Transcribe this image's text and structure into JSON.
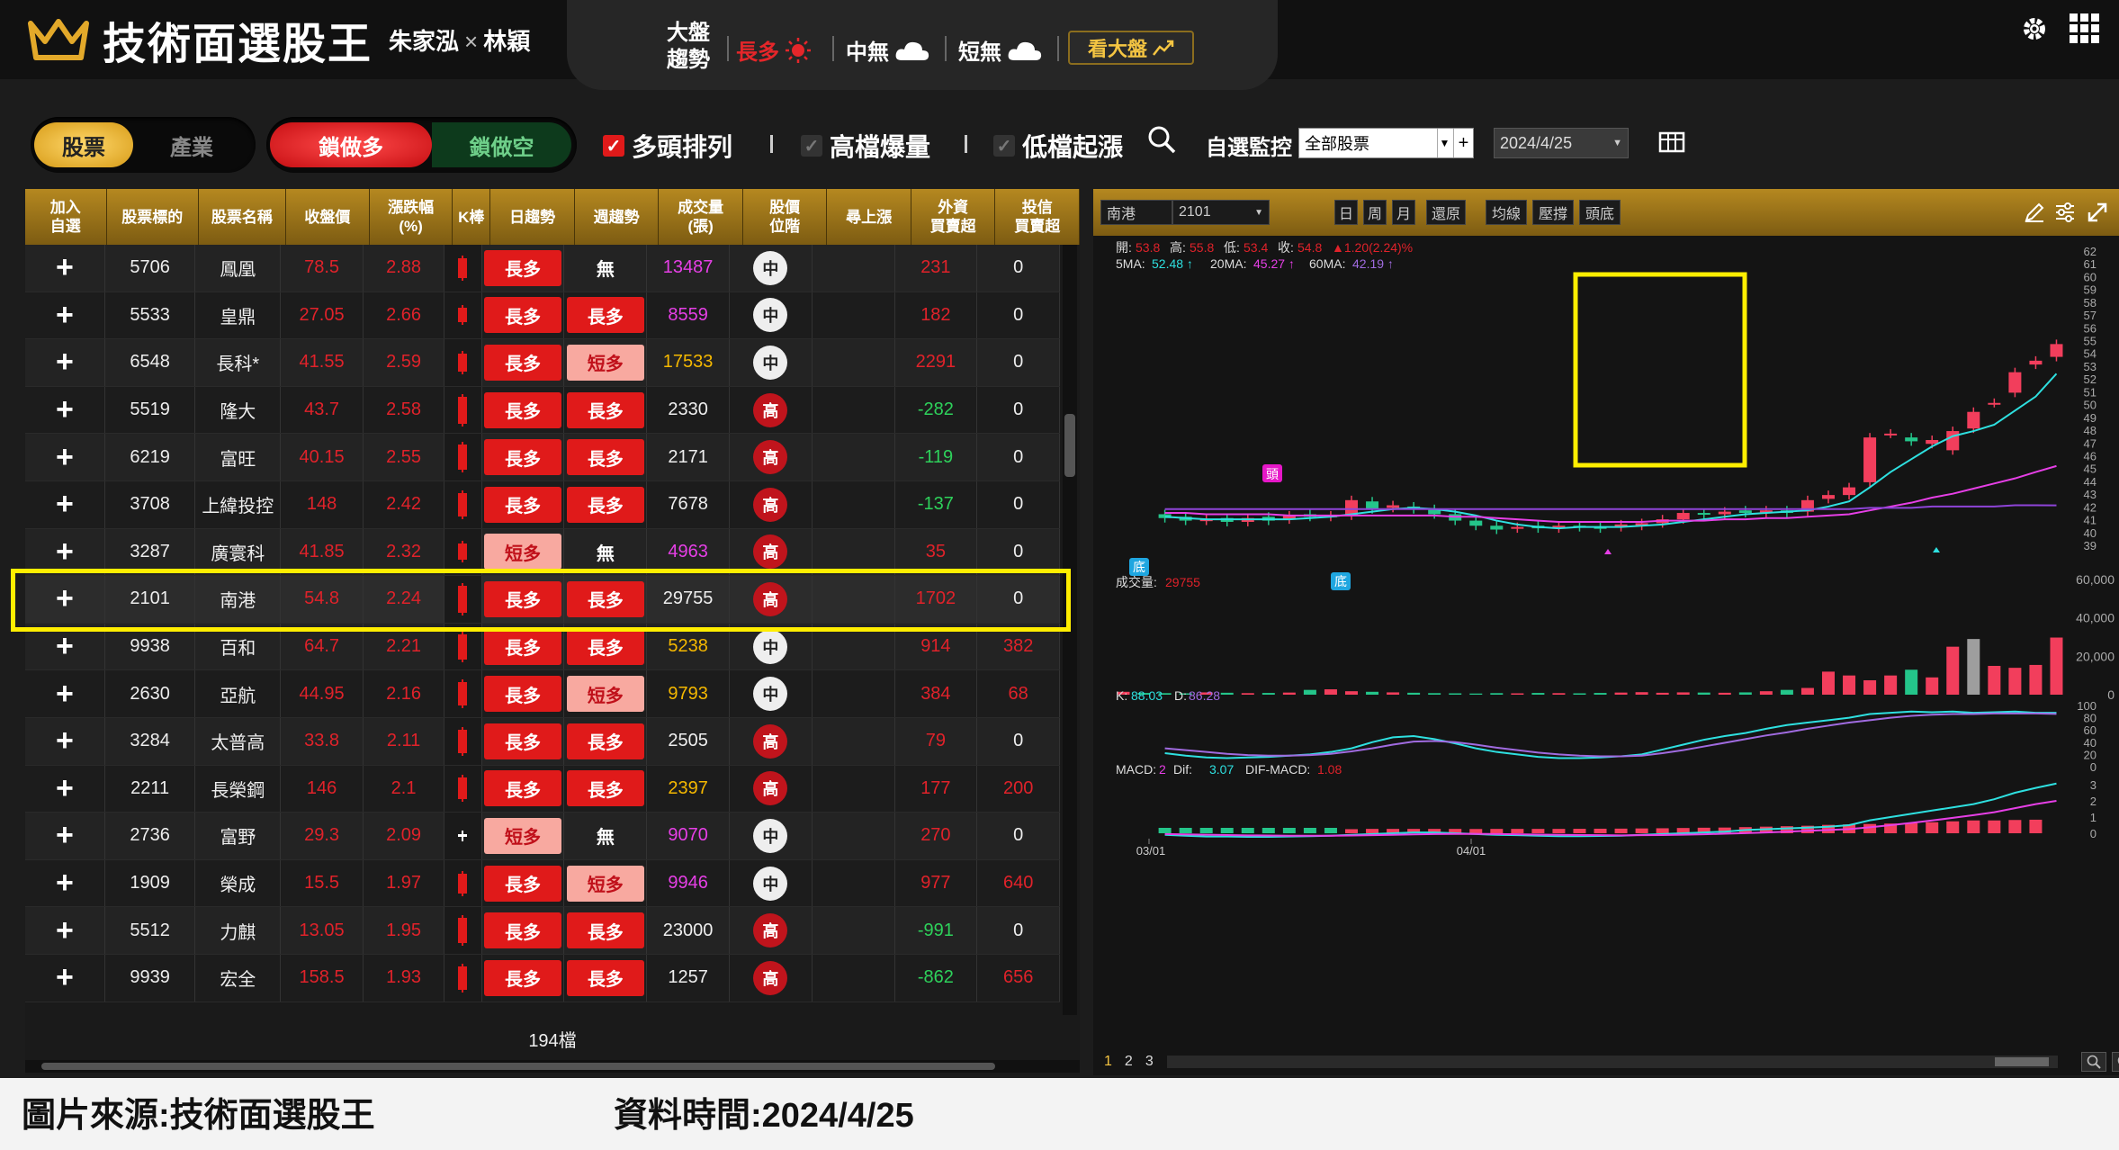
{
  "app": {
    "title": "技術面選股王",
    "host_1": "朱家泓",
    "host_x": "×",
    "host_2": "林穎"
  },
  "market_trend": {
    "label_line1": "大盤",
    "label_line2": "趨勢",
    "long": "長多",
    "mid": "中無",
    "short": "短無",
    "see_market": "看大盤"
  },
  "toolbar": {
    "tab_stocks": "股票",
    "tab_industry": "產業",
    "tab_lock_long": "鎖做多",
    "tab_lock_short": "鎖做空",
    "filter_1": "多頭排列",
    "filter_1_checked": true,
    "filter_2": "高檔爆量",
    "filter_2_checked": false,
    "filter_3": "低檔起漲",
    "filter_3_checked": false,
    "watch_label": "自選監控",
    "watch_value": "全部股票",
    "date_value": "2024/4/25"
  },
  "table": {
    "headers": [
      "加入\n自選",
      "股票標的",
      "股票名稱",
      "收盤價",
      "漲跌幅\n(%)",
      "K棒",
      "日趨勢",
      "週趨勢",
      "成交量\n(張)",
      "股價\n位階",
      "尋上漲",
      "外資\n買賣超",
      "投信\n買賣超"
    ],
    "rows": [
      {
        "add": "+",
        "code": "5706",
        "name": "鳳凰",
        "close": "78.5",
        "chg": "2.88",
        "day": "長多",
        "day_t": "long",
        "week": "無",
        "week_t": "none",
        "vol": "13487",
        "vol_c": "mag",
        "pos": "中",
        "pos_t": "mid",
        "fi": "231",
        "fi_c": "red",
        "it": "0",
        "it_c": "white"
      },
      {
        "add": "+",
        "code": "5533",
        "name": "皇鼎",
        "close": "27.05",
        "chg": "2.66",
        "day": "長多",
        "day_t": "long",
        "week": "長多",
        "week_t": "long",
        "vol": "8559",
        "vol_c": "mag",
        "pos": "中",
        "pos_t": "mid",
        "fi": "182",
        "fi_c": "red",
        "it": "0",
        "it_c": "white"
      },
      {
        "add": "+",
        "code": "6548",
        "name": "長科*",
        "close": "41.55",
        "chg": "2.59",
        "day": "長多",
        "day_t": "long",
        "week": "短多",
        "week_t": "short",
        "vol": "17533",
        "vol_c": "yel",
        "pos": "中",
        "pos_t": "mid",
        "fi": "2291",
        "fi_c": "red",
        "it": "0",
        "it_c": "white"
      },
      {
        "add": "+",
        "code": "5519",
        "name": "隆大",
        "close": "43.7",
        "chg": "2.58",
        "day": "長多",
        "day_t": "long",
        "week": "長多",
        "week_t": "long",
        "vol": "2330",
        "vol_c": "white",
        "pos": "高",
        "pos_t": "high",
        "fi": "-282",
        "fi_c": "green",
        "it": "0",
        "it_c": "white"
      },
      {
        "add": "+",
        "code": "6219",
        "name": "富旺",
        "close": "40.15",
        "chg": "2.55",
        "day": "長多",
        "day_t": "long",
        "week": "長多",
        "week_t": "long",
        "vol": "2171",
        "vol_c": "white",
        "pos": "高",
        "pos_t": "high",
        "fi": "-119",
        "fi_c": "green",
        "it": "0",
        "it_c": "white"
      },
      {
        "add": "+",
        "code": "3708",
        "name": "上緯投控",
        "close": "148",
        "chg": "2.42",
        "day": "長多",
        "day_t": "long",
        "week": "長多",
        "week_t": "long",
        "vol": "7678",
        "vol_c": "white",
        "pos": "高",
        "pos_t": "high",
        "fi": "-137",
        "fi_c": "green",
        "it": "0",
        "it_c": "white"
      },
      {
        "add": "+",
        "code": "3287",
        "name": "廣寰科",
        "close": "41.85",
        "chg": "2.32",
        "day": "短多",
        "day_t": "short",
        "week": "無",
        "week_t": "none",
        "vol": "4963",
        "vol_c": "mag",
        "pos": "高",
        "pos_t": "high",
        "fi": "35",
        "fi_c": "red",
        "it": "0",
        "it_c": "white"
      },
      {
        "add": "+",
        "code": "2101",
        "name": "南港",
        "close": "54.8",
        "chg": "2.24",
        "day": "長多",
        "day_t": "long",
        "week": "長多",
        "week_t": "long",
        "vol": "29755",
        "vol_c": "white",
        "pos": "高",
        "pos_t": "high",
        "fi": "1702",
        "fi_c": "red",
        "it": "0",
        "it_c": "white"
      },
      {
        "add": "+",
        "code": "9938",
        "name": "百和",
        "close": "64.7",
        "chg": "2.21",
        "day": "長多",
        "day_t": "long",
        "week": "長多",
        "week_t": "long",
        "vol": "5238",
        "vol_c": "yel",
        "pos": "中",
        "pos_t": "mid",
        "fi": "914",
        "fi_c": "red",
        "it": "382",
        "it_c": "red"
      },
      {
        "add": "+",
        "code": "2630",
        "name": "亞航",
        "close": "44.95",
        "chg": "2.16",
        "day": "長多",
        "day_t": "long",
        "week": "短多",
        "week_t": "short",
        "vol": "9793",
        "vol_c": "yel",
        "pos": "中",
        "pos_t": "mid",
        "fi": "384",
        "fi_c": "red",
        "it": "68",
        "it_c": "red"
      },
      {
        "add": "+",
        "code": "3284",
        "name": "太普高",
        "close": "33.8",
        "chg": "2.11",
        "day": "長多",
        "day_t": "long",
        "week": "長多",
        "week_t": "long",
        "vol": "2505",
        "vol_c": "white",
        "pos": "高",
        "pos_t": "high",
        "fi": "79",
        "fi_c": "red",
        "it": "0",
        "it_c": "white"
      },
      {
        "add": "+",
        "code": "2211",
        "name": "長榮鋼",
        "close": "146",
        "chg": "2.1",
        "day": "長多",
        "day_t": "long",
        "week": "長多",
        "week_t": "long",
        "vol": "2397",
        "vol_c": "yel",
        "pos": "高",
        "pos_t": "high",
        "fi": "177",
        "fi_c": "red",
        "it": "200",
        "it_c": "red"
      },
      {
        "add": "+",
        "code": "2736",
        "name": "富野",
        "close": "29.3",
        "chg": "2.09",
        "day": "短多",
        "day_t": "short",
        "week": "無",
        "week_t": "none",
        "vol": "9070",
        "vol_c": "mag",
        "pos": "中",
        "pos_t": "mid",
        "fi": "270",
        "fi_c": "red",
        "it": "0",
        "it_c": "white"
      },
      {
        "add": "+",
        "code": "1909",
        "name": "榮成",
        "close": "15.5",
        "chg": "1.97",
        "day": "長多",
        "day_t": "long",
        "week": "短多",
        "week_t": "short",
        "vol": "9946",
        "vol_c": "mag",
        "pos": "中",
        "pos_t": "mid",
        "fi": "977",
        "fi_c": "red",
        "it": "640",
        "it_c": "red"
      },
      {
        "add": "+",
        "code": "5512",
        "name": "力麒",
        "close": "13.05",
        "chg": "1.95",
        "day": "長多",
        "day_t": "long",
        "week": "長多",
        "week_t": "long",
        "vol": "23000",
        "vol_c": "white",
        "pos": "高",
        "pos_t": "high",
        "fi": "-991",
        "fi_c": "green",
        "it": "0",
        "it_c": "white"
      },
      {
        "add": "+",
        "code": "9939",
        "name": "宏全",
        "close": "158.5",
        "chg": "1.93",
        "day": "長多",
        "day_t": "long",
        "week": "長多",
        "week_t": "long",
        "vol": "1257",
        "vol_c": "white",
        "pos": "高",
        "pos_t": "high",
        "fi": "-862",
        "fi_c": "green",
        "it": "656",
        "it_c": "red"
      }
    ],
    "count_text": "194檔"
  },
  "chart": {
    "symbol": "南港",
    "code": "2101",
    "btn_day": "日",
    "btn_week": "周",
    "btn_month": "月",
    "btn_restore": "還原",
    "btn_ma": "均線",
    "btn_sr": "壓撐",
    "btn_head": "頭底",
    "ohlc": {
      "open_l": "開:",
      "open": "53.8",
      "high_l": "高:",
      "high": "55.8",
      "low_l": "低:",
      "low": "53.4",
      "close_l": "收:",
      "close": "54.8",
      "chg": "▲1.20(2.24)%"
    },
    "ma": {
      "ma5_l": "5MA:",
      "ma5": "52.48",
      "ma20_l": "20MA:",
      "ma20": "45.27",
      "ma60_l": "60MA:",
      "ma60": "42.19"
    },
    "vol_label": "成交量:",
    "vol_value": "29755",
    "kd_k_l": "K:",
    "kd_k": "88.03",
    "kd_d_l": "D:",
    "kd_d": "86.28",
    "macd_l": "MACD:",
    "macd": "2",
    "dif_l": "Dif:",
    "dif": "3.07",
    "difmacd_l": "DIF-MACD:",
    "difmacd": "1.08",
    "head_tag": "頭",
    "bottom_tag": "底",
    "date_1": "03/01",
    "date_2": "04/01",
    "price_ticks": [
      "62",
      "61",
      "60",
      "59",
      "58",
      "57",
      "56",
      "55",
      "54",
      "53",
      "52",
      "51",
      "50",
      "49",
      "48",
      "47",
      "46",
      "45",
      "44",
      "43",
      "42",
      "41",
      "40",
      "39"
    ],
    "vol_ticks": [
      "60,000",
      "40,000",
      "20,000",
      "0"
    ],
    "kd_ticks": [
      "100",
      "80",
      "60",
      "40",
      "20",
      "0"
    ],
    "macd_ticks": [
      "3",
      "2",
      "1",
      "0"
    ],
    "pages": [
      "1",
      "2",
      "3"
    ]
  },
  "chart_data": {
    "type": "candlestick",
    "title": "南港 2101",
    "x_ticks": [
      "03/01",
      "04/01"
    ],
    "ylim": [
      39,
      62
    ],
    "candles": [
      {
        "o": 41.5,
        "c": 41.2
      },
      {
        "o": 41.3,
        "c": 41.0
      },
      {
        "o": 41.0,
        "c": 41.1
      },
      {
        "o": 41.2,
        "c": 40.9
      },
      {
        "o": 40.9,
        "c": 41.2
      },
      {
        "o": 41.3,
        "c": 41.0
      },
      {
        "o": 41.1,
        "c": 41.4
      },
      {
        "o": 41.5,
        "c": 41.3
      },
      {
        "o": 41.3,
        "c": 41.4
      },
      {
        "o": 41.4,
        "c": 42.6
      },
      {
        "o": 42.5,
        "c": 41.9
      },
      {
        "o": 42.0,
        "c": 42.2
      },
      {
        "o": 42.1,
        "c": 41.9
      },
      {
        "o": 41.9,
        "c": 41.5
      },
      {
        "o": 41.5,
        "c": 41.0
      },
      {
        "o": 41.0,
        "c": 40.6
      },
      {
        "o": 40.6,
        "c": 40.3
      },
      {
        "o": 40.4,
        "c": 40.5
      },
      {
        "o": 40.6,
        "c": 40.4
      },
      {
        "o": 40.4,
        "c": 40.6
      },
      {
        "o": 40.6,
        "c": 40.5
      },
      {
        "o": 40.5,
        "c": 40.4
      },
      {
        "o": 40.5,
        "c": 40.7
      },
      {
        "o": 40.6,
        "c": 40.8
      },
      {
        "o": 40.8,
        "c": 41.1
      },
      {
        "o": 41.1,
        "c": 41.6
      },
      {
        "o": 41.6,
        "c": 41.5
      },
      {
        "o": 41.5,
        "c": 41.7
      },
      {
        "o": 41.8,
        "c": 41.6
      },
      {
        "o": 41.6,
        "c": 41.8
      },
      {
        "o": 41.8,
        "c": 41.6
      },
      {
        "o": 41.7,
        "c": 42.6
      },
      {
        "o": 42.7,
        "c": 43.0
      },
      {
        "o": 43.0,
        "c": 43.6
      },
      {
        "o": 44.0,
        "c": 47.5
      },
      {
        "o": 47.8,
        "c": 47.8
      },
      {
        "o": 47.5,
        "c": 47.2
      },
      {
        "o": 47.0,
        "c": 47.3
      },
      {
        "o": 46.5,
        "c": 48.0
      },
      {
        "o": 48.2,
        "c": 49.5
      },
      {
        "o": 50.2,
        "c": 50.2
      },
      {
        "o": 51.0,
        "c": 52.6
      },
      {
        "o": 53.2,
        "c": 53.5
      },
      {
        "o": 53.8,
        "c": 54.8
      }
    ],
    "ma5": [
      41.3,
      41.2,
      41.1,
      41.1,
      41.1,
      41.1,
      41.1,
      41.2,
      41.3,
      41.5,
      41.7,
      41.9,
      42.0,
      41.9,
      41.7,
      41.4,
      41.0,
      40.7,
      40.5,
      40.4,
      40.5,
      40.5,
      40.5,
      40.6,
      40.7,
      40.9,
      41.1,
      41.3,
      41.5,
      41.6,
      41.7,
      41.8,
      42.1,
      42.5,
      43.6,
      44.8,
      45.8,
      46.8,
      47.6,
      48.0,
      48.5,
      49.6,
      50.7,
      52.48
    ],
    "ma20": [
      41.6,
      41.6,
      41.5,
      41.5,
      41.5,
      41.5,
      41.4,
      41.4,
      41.4,
      41.4,
      41.4,
      41.4,
      41.4,
      41.4,
      41.3,
      41.3,
      41.2,
      41.1,
      41.0,
      40.9,
      40.9,
      40.9,
      40.9,
      40.9,
      41.0,
      41.0,
      41.0,
      41.1,
      41.1,
      41.2,
      41.2,
      41.3,
      41.4,
      41.5,
      41.8,
      42.1,
      42.4,
      42.8,
      43.1,
      43.5,
      43.9,
      44.3,
      44.8,
      45.27
    ],
    "ma60": [
      41.9,
      41.9,
      41.9,
      41.9,
      41.9,
      41.9,
      41.9,
      41.9,
      41.9,
      41.9,
      41.9,
      41.9,
      41.9,
      41.9,
      41.9,
      41.9,
      41.9,
      41.9,
      41.9,
      41.9,
      41.9,
      41.9,
      41.9,
      41.9,
      41.9,
      41.9,
      41.9,
      41.9,
      41.9,
      41.9,
      41.9,
      41.9,
      41.9,
      41.9,
      42.0,
      42.0,
      42.0,
      42.1,
      42.1,
      42.1,
      42.1,
      42.2,
      42.2,
      42.19
    ],
    "volume": [
      1500,
      900,
      800,
      700,
      1200,
      1000,
      800,
      900,
      1100,
      2500,
      2800,
      1800,
      1500,
      1200,
      1000,
      800,
      700,
      600,
      800,
      700,
      900,
      800,
      700,
      900,
      1100,
      1300,
      1000,
      1200,
      1100,
      1000,
      1200,
      1800,
      2500,
      3500,
      12000,
      10000,
      7500,
      10000,
      13000,
      9000,
      25000,
      29000,
      15000,
      14000,
      15500,
      29755
    ],
    "k": [
      22,
      18,
      15,
      14,
      15,
      16,
      18,
      20,
      24,
      30,
      40,
      48,
      50,
      45,
      38,
      30,
      24,
      20,
      16,
      14,
      14,
      15,
      17,
      20,
      28,
      36,
      44,
      50,
      55,
      62,
      68,
      72,
      76,
      80,
      86,
      88,
      90,
      89,
      90,
      88,
      89,
      90,
      88,
      88.03
    ],
    "d": [
      30,
      27,
      24,
      21,
      19,
      18,
      18,
      19,
      21,
      25,
      30,
      36,
      41,
      42,
      40,
      36,
      31,
      27,
      23,
      20,
      18,
      17,
      17,
      18,
      22,
      27,
      33,
      39,
      45,
      51,
      56,
      62,
      67,
      72,
      76,
      80,
      83,
      85,
      86,
      86,
      87,
      87,
      87,
      86.28
    ],
    "dif": [
      -0.1,
      -0.15,
      -0.2,
      -0.2,
      -0.22,
      -0.22,
      -0.2,
      -0.18,
      -0.15,
      -0.1,
      -0.05,
      0.0,
      0.05,
      0.05,
      0.0,
      -0.05,
      -0.1,
      -0.12,
      -0.15,
      -0.18,
      -0.18,
      -0.17,
      -0.15,
      -0.1,
      -0.05,
      0.0,
      0.05,
      0.1,
      0.2,
      0.25,
      0.3,
      0.35,
      0.4,
      0.5,
      0.8,
      1.0,
      1.2,
      1.4,
      1.6,
      1.8,
      2.1,
      2.5,
      2.8,
      3.07
    ],
    "macd": [
      -0.05,
      -0.07,
      -0.09,
      -0.11,
      -0.13,
      -0.14,
      -0.15,
      -0.15,
      -0.15,
      -0.14,
      -0.12,
      -0.1,
      -0.07,
      -0.05,
      -0.04,
      -0.04,
      -0.05,
      -0.06,
      -0.08,
      -0.1,
      -0.11,
      -0.12,
      -0.13,
      -0.12,
      -0.11,
      -0.09,
      -0.06,
      -0.03,
      0.01,
      0.05,
      0.1,
      0.15,
      0.2,
      0.26,
      0.37,
      0.5,
      0.64,
      0.79,
      0.95,
      1.12,
      1.3,
      1.55,
      1.8,
      2.0
    ],
    "osc": [
      -0.1,
      -0.1,
      -0.1,
      -0.1,
      -0.1,
      -0.1,
      -0.1,
      -0.06,
      -0.03,
      0.02,
      0.05,
      0.05,
      0.05,
      0.05,
      0.05,
      0.04,
      0.05,
      0.05,
      0.05,
      0.05,
      0.06,
      0.07,
      0.08,
      0.1,
      0.12,
      0.15,
      0.18,
      0.2,
      0.25,
      0.3,
      0.35,
      0.4,
      0.5,
      0.55,
      0.6,
      0.65,
      0.7,
      0.8,
      0.9,
      1.0,
      1.0,
      1.05,
      1.08
    ]
  },
  "caption": {
    "source": "圖片來源:技術面選股王",
    "date": "資料時間:2024/4/25"
  }
}
